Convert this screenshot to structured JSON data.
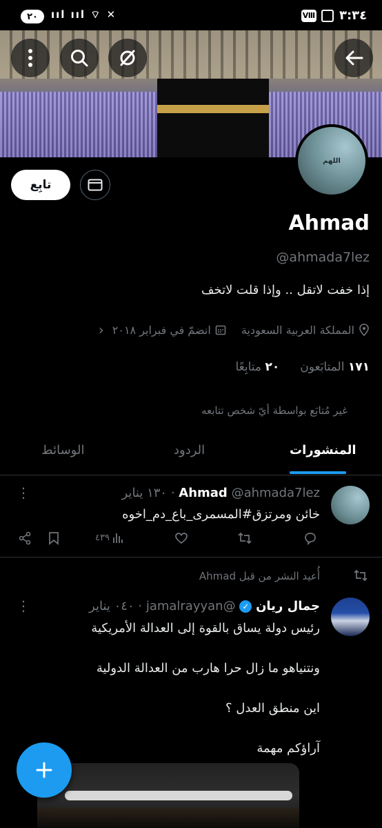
{
  "status_bar": {
    "time": "٣:٣٤",
    "notif_count": "٢٠",
    "carrier_badge": "Ⅷ"
  },
  "header": {
    "back_icon": "back-arrow-icon",
    "hide_icon": "eye-slash-icon",
    "search_icon": "search-icon",
    "more_icon": "more-vertical-icon"
  },
  "profile": {
    "name": "Ahmad",
    "handle": "@ahmada7lez",
    "bio": "إذا خفت لاتقل .. وإذا قلت لاتخف",
    "location": "المملكة العربية السعودية",
    "joined": "انضمّ في فبراير ٢٠١٨",
    "followers_count": "١٧١",
    "followers_label": "المتابَعون",
    "following_count": "٢٠",
    "following_label": "متابِعًا",
    "not_followed": "غير مُتابَع بواسطة أيّ شخص تتابعه",
    "follow_button": "تابِع",
    "avatar_caption": "اللهم"
  },
  "tabs": [
    {
      "label": "المنشورات",
      "active": true
    },
    {
      "label": "الردود",
      "active": false
    },
    {
      "label": "الوسائط",
      "active": false
    }
  ],
  "tweets": [
    {
      "name": "Ahmad",
      "handle": "@ahmada7lez",
      "date": "١٣٠ يناير",
      "text": "خائن ومرتزق#المسمرى_باع_دم_اخوه",
      "views": "٤٣٩"
    },
    {
      "retweet_label": "أُعيد النشر من قبل Ahmad",
      "name": "جمال ريان",
      "handle": "@jamalrayyan",
      "date": "٠٤٠ يناير",
      "lines": [
        "رئيس دولة يساق بالقوة إلى العدالة الأمريكية",
        "ونتنياهو ما زال حرا هارب من العدالة الدولية",
        "اين منطق العدل ؟",
        "آراؤكم مهمة"
      ]
    }
  ],
  "colors": {
    "accent": "#1d9bf0",
    "background": "#000000",
    "muted": "#71767b"
  }
}
